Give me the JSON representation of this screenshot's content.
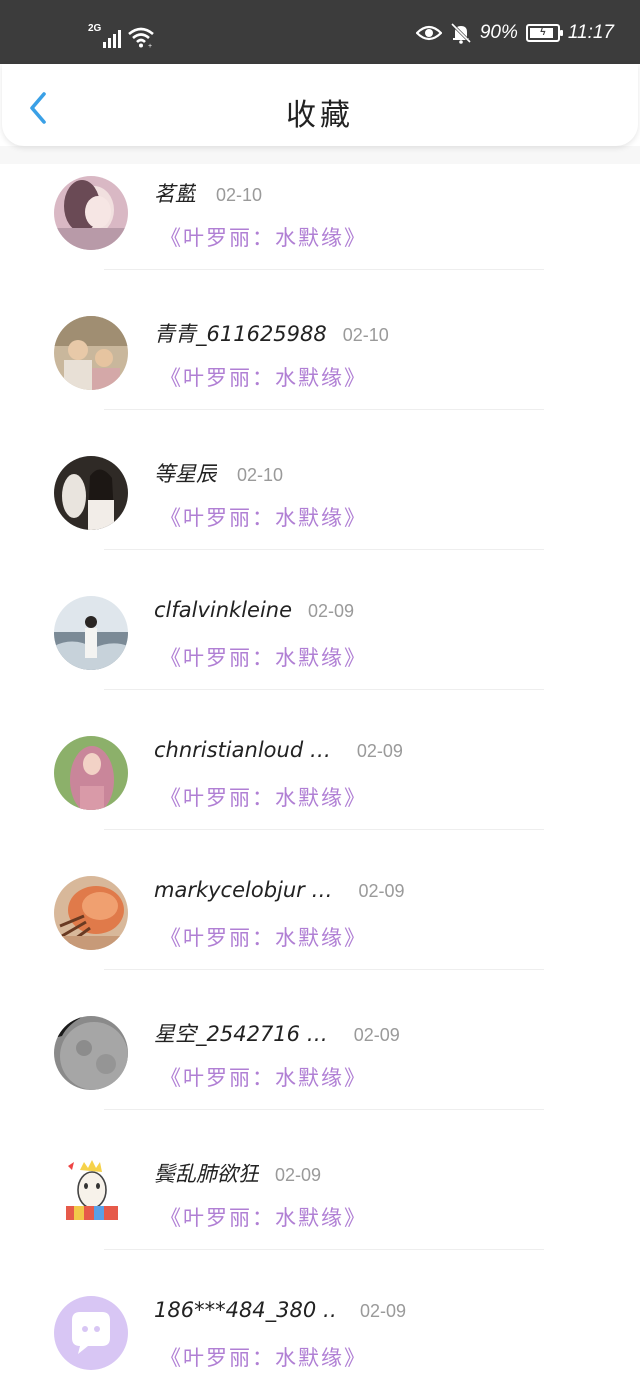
{
  "status_bar": {
    "network": "2G",
    "battery_percent": "90%",
    "battery_level": 0.9,
    "time": "11:17"
  },
  "header": {
    "title": "收藏",
    "back_icon": "chevron-left-icon"
  },
  "colors": {
    "status_bar_bg": "#3c3c3c",
    "accent_back": "#3aa0e6",
    "book_title": "#b07fd4",
    "date": "#9a9a9a"
  },
  "favorites": [
    {
      "username": "茗藍",
      "date": "02-10",
      "book": "《叶罗丽：水默缘》",
      "avatar": "avatar-pink-portrait"
    },
    {
      "username": "青青_611625988",
      "date": "02-10",
      "book": "《叶罗丽：水默缘》",
      "avatar": "avatar-family-photo"
    },
    {
      "username": "等星辰",
      "date": "02-10",
      "book": "《叶罗丽：水默缘》",
      "avatar": "avatar-girl-with-deer"
    },
    {
      "username": "clfalvinkleine",
      "date": "02-09",
      "book": "《叶罗丽：水默缘》",
      "avatar": "avatar-girl-by-sea"
    },
    {
      "username": "chnristianloud …",
      "date": "02-09",
      "book": "《叶罗丽：水默缘》",
      "avatar": "avatar-pink-hair-girl"
    },
    {
      "username": "markycelobjur …",
      "date": "02-09",
      "book": "《叶罗丽：水默缘》",
      "avatar": "avatar-hermit-crab"
    },
    {
      "username": "星空_2542716 …",
      "date": "02-09",
      "book": "《叶罗丽：水默缘》",
      "avatar": "avatar-moon"
    },
    {
      "username": "鬓乱肺欲狂",
      "date": "02-09",
      "book": "《叶罗丽：水默缘》",
      "avatar": "avatar-cartoon-king"
    },
    {
      "username": "186***484_380 …",
      "date": "02-09",
      "book": "《叶罗丽：水默缘》",
      "avatar": "avatar-default-chat"
    }
  ]
}
